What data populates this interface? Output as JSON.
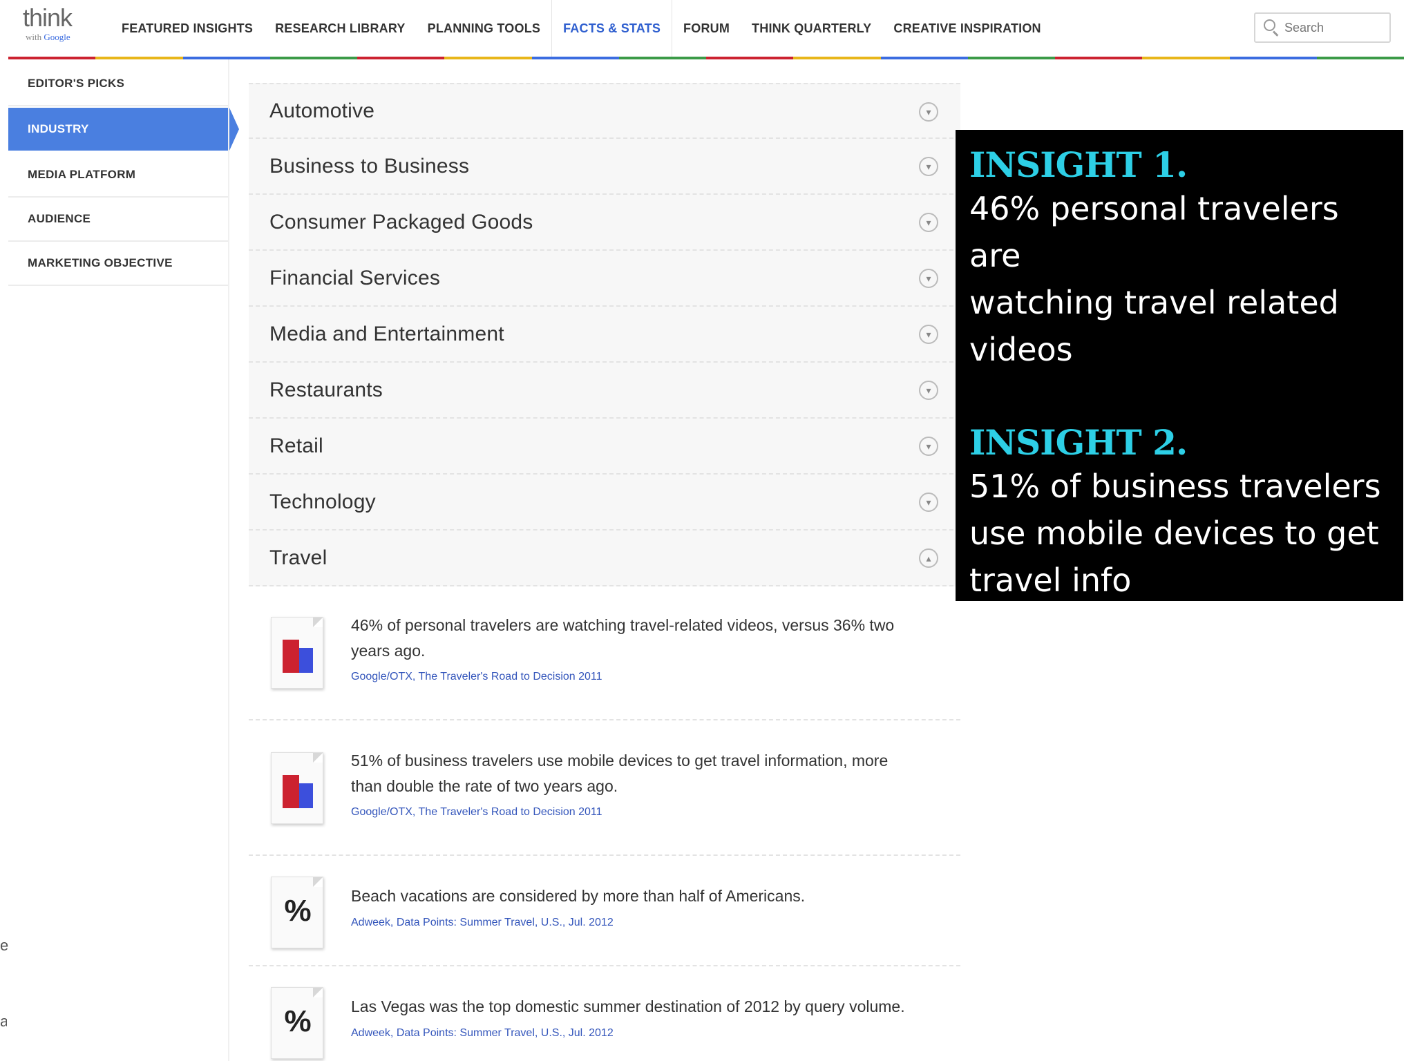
{
  "logo": {
    "main": "think",
    "sub_prefix": "with",
    "sub_brand": "Google"
  },
  "nav": {
    "items": [
      {
        "label": "FEATURED INSIGHTS"
      },
      {
        "label": "RESEARCH LIBRARY"
      },
      {
        "label": "PLANNING TOOLS"
      },
      {
        "label": "FACTS & STATS",
        "active": true
      },
      {
        "label": "FORUM"
      },
      {
        "label": "THINK QUARTERLY"
      },
      {
        "label": "CREATIVE INSPIRATION"
      }
    ]
  },
  "search": {
    "placeholder": "Search"
  },
  "colors": {
    "accent_blue": "#4a7fe0",
    "nav_active": "#2f5fcf",
    "bar": [
      "#cc2230",
      "#e8b61a",
      "#3b6ce0",
      "#3b9a47"
    ],
    "insight_title": "#2dcfe6"
  },
  "sidebar": {
    "items": [
      {
        "label": "EDITOR'S PICKS"
      },
      {
        "label": "INDUSTRY",
        "active": true
      },
      {
        "label": "MEDIA PLATFORM"
      },
      {
        "label": "AUDIENCE"
      },
      {
        "label": "MARKETING OBJECTIVE"
      }
    ]
  },
  "accordion": {
    "items": [
      {
        "label": "Automotive",
        "icon": "chevron-down-icon"
      },
      {
        "label": "Business to Business",
        "icon": "chevron-down-icon"
      },
      {
        "label": "Consumer Packaged Goods",
        "icon": "chevron-down-icon"
      },
      {
        "label": "Financial Services",
        "icon": "chevron-down-icon"
      },
      {
        "label": "Media and Entertainment",
        "icon": "chevron-down-icon"
      },
      {
        "label": "Restaurants",
        "icon": "chevron-down-icon"
      },
      {
        "label": "Retail",
        "icon": "chevron-down-icon"
      },
      {
        "label": "Technology",
        "icon": "chevron-down-icon"
      },
      {
        "label": "Travel",
        "icon": "chevron-up-icon",
        "expanded": true
      }
    ]
  },
  "facts": [
    {
      "icon": "bar-chart-icon",
      "text_line1": "46% of personal travelers are watching travel-related videos, versus 36% two",
      "text_line2": "years ago.",
      "source": "Google/OTX, The Traveler's Road to Decision 2011"
    },
    {
      "icon": "bar-chart-icon",
      "text_line1": "51% of business travelers use mobile devices to get travel information, more",
      "text_line2": "than double the rate of two years ago.",
      "source": "Google/OTX, The Traveler's Road to Decision 2011"
    },
    {
      "icon": "percent-icon",
      "icon_text": "%",
      "text_line1": "Beach vacations are considered by more than half of Americans.",
      "source": "Adweek, Data Points: Summer Travel, U.S., Jul. 2012"
    },
    {
      "icon": "percent-icon",
      "icon_text": "%",
      "text_line1": "Las Vegas was the top domestic summer destination of 2012 by query volume.",
      "source": "Adweek, Data Points: Summer Travel, U.S., Jul. 2012"
    }
  ],
  "insights": [
    {
      "title": "INSIGHT 1.",
      "line1": "46% personal travelers are",
      "line2": "watching travel related",
      "line3": "videos"
    },
    {
      "title": "INSIGHT 2.",
      "line1": "51% of business travelers",
      "line2": "use mobile devices to get",
      "line3": "travel info"
    }
  ],
  "edge_fragments": [
    "e",
    "al"
  ]
}
